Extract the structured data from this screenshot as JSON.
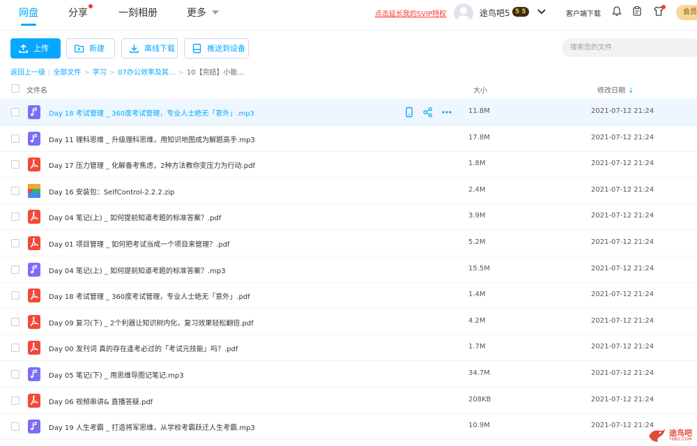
{
  "nav": {
    "tabs": [
      {
        "label": "网盘",
        "active": true
      },
      {
        "label": "分享",
        "badge": true
      },
      {
        "label": "一刻相册"
      },
      {
        "label": "更多",
        "dropdown": true
      }
    ],
    "svip_link": "点击延长我的SVIP特权",
    "username": "途鸟吧5",
    "vip_badge": "5 5",
    "client_download": "客户端下载",
    "gold_button": "会员",
    "icons": [
      "bell-icon",
      "clipboard-icon",
      "shirt-icon"
    ],
    "colors": {
      "accent": "#06a7ff",
      "alert": "#ff3333"
    }
  },
  "toolbar": {
    "upload": "上传",
    "new": "新建",
    "offline_download": "离线下载",
    "push_to_device": "推送到设备",
    "search_placeholder": "搜索您的文件"
  },
  "breadcrumb": {
    "back": "返回上一级",
    "items": [
      "全部文件",
      "学习",
      "07办公效率及其...",
      "10【完结】小能..."
    ]
  },
  "table": {
    "columns": {
      "name": "文件名",
      "size": "大小",
      "modified": "修改日期"
    },
    "sort": {
      "column": "modified",
      "direction": "desc"
    },
    "rows": [
      {
        "type": "mp3",
        "name": "Day 18 考试管理 _ 360度考试管理，专业人士绝无「意外」.mp3",
        "size": "11.8M",
        "date": "2021-07-12 21:24",
        "highlighted": true
      },
      {
        "type": "mp3",
        "name": "Day 11 理科思维 _ 升级理科思维，用知识地图成为解题高手.mp3",
        "size": "17.8M",
        "date": "2021-07-12 21:24"
      },
      {
        "type": "pdf",
        "name": "Day 17 压力管理 _ 化解备考焦虑，2种方法教你变压力为行动.pdf",
        "size": "1.8M",
        "date": "2021-07-12 21:24"
      },
      {
        "type": "zip",
        "name": "Day 16 安装包：SelfControl-2.2.2.zip",
        "size": "2.4M",
        "date": "2021-07-12 21:24"
      },
      {
        "type": "pdf",
        "name": "Day 04 笔记(上) _ 如何提前知道考题的标准答案？.pdf",
        "size": "3.9M",
        "date": "2021-07-12 21:24"
      },
      {
        "type": "pdf",
        "name": "Day 01 项目管理 _ 如何把考试当成一个项目来管理？.pdf",
        "size": "5.2M",
        "date": "2021-07-12 21:24"
      },
      {
        "type": "mp3",
        "name": "Day 04 笔记(上) _ 如何提前知道考题的标准答案？.mp3",
        "size": "15.5M",
        "date": "2021-07-12 21:24"
      },
      {
        "type": "pdf",
        "name": "Day 18 考试管理 _ 360度考试管理，专业人士绝无「意外」.pdf",
        "size": "1.4M",
        "date": "2021-07-12 21:24"
      },
      {
        "type": "pdf",
        "name": "Day 09 复习(下) _ 2个利器让知识树内化，复习效果轻松翻倍.pdf",
        "size": "4.2M",
        "date": "2021-07-12 21:24"
      },
      {
        "type": "pdf",
        "name": "Day 00 发刊词 真的存在逢考必过的「考试元技能」吗？.pdf",
        "size": "1.7M",
        "date": "2021-07-12 21:24"
      },
      {
        "type": "mp3",
        "name": "Day 05 笔记(下) _ 用思维导图记笔记.mp3",
        "size": "34.7M",
        "date": "2021-07-12 21:24"
      },
      {
        "type": "pdf",
        "name": "Day 06 视频串讲& 直播答疑.pdf",
        "size": "208KB",
        "date": "2021-07-12 21:24"
      },
      {
        "type": "mp3",
        "name": "Day 19 人生考霸 _ 打造将军思维，从学校考霸跃迁人生考霸.mp3",
        "size": "10.9M",
        "date": "2021-07-12 21:24"
      }
    ]
  },
  "row_actions": [
    "phone-icon",
    "share-icon",
    "more-icon"
  ],
  "watermark": {
    "text": "途鸟吧",
    "sub": "TNBZ.COM"
  }
}
